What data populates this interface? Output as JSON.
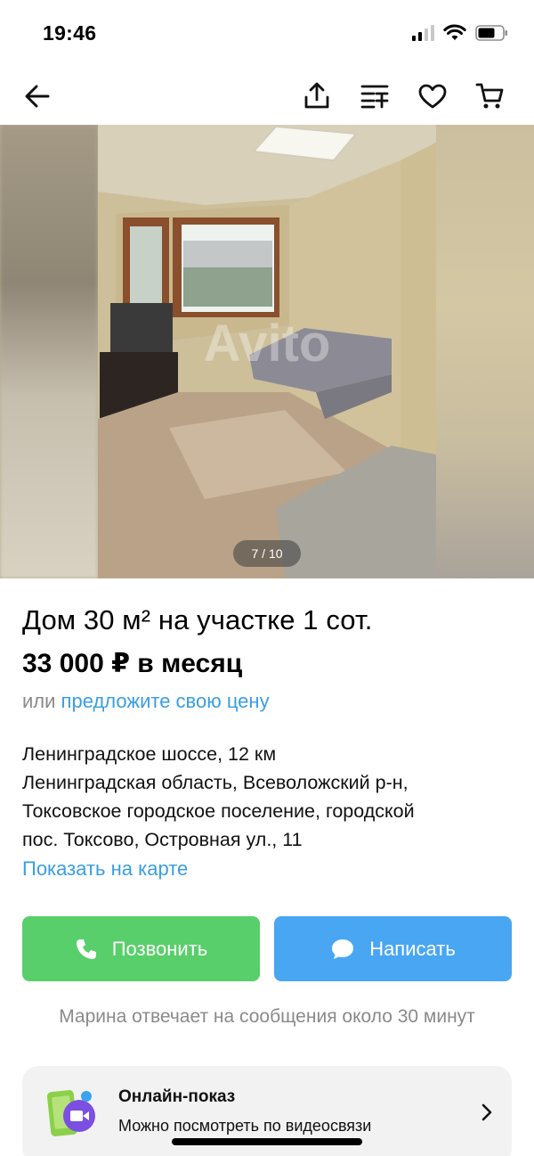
{
  "status_bar": {
    "time": "19:46"
  },
  "nav": {
    "back_icon": "arrow-left-icon",
    "actions": [
      "share-icon",
      "compare-icon",
      "heart-icon",
      "cart-icon"
    ]
  },
  "gallery": {
    "counter": "7 / 10",
    "watermark": "Avito"
  },
  "listing": {
    "title": "Дом 30 м² на участке 1 сот.",
    "price": "33 000 ₽ в месяц",
    "offer_prefix": "или",
    "offer_link": "предложите свою цену",
    "address_lines": [
      "Ленинградское шоссе, 12 км",
      "Ленинградская область, Всеволожский р-н,",
      "Токсовское городское поселение, городской",
      "пос. Токсово, Островная ул., 11"
    ],
    "map_link": "Показать на карте"
  },
  "actions": {
    "call_label": "Позвонить",
    "write_label": "Написать",
    "call_color": "#58cf6a",
    "write_color": "#48a6f3"
  },
  "reply_note": "Марина отвечает на сообщения около 30 минут",
  "online_show": {
    "title": "Онлайн-показ",
    "subtitle": "Можно посмотреть по видеосвязи",
    "icon": "video-call-icon"
  },
  "colors": {
    "link": "#3a9ee0",
    "muted": "#8a8a8a"
  }
}
